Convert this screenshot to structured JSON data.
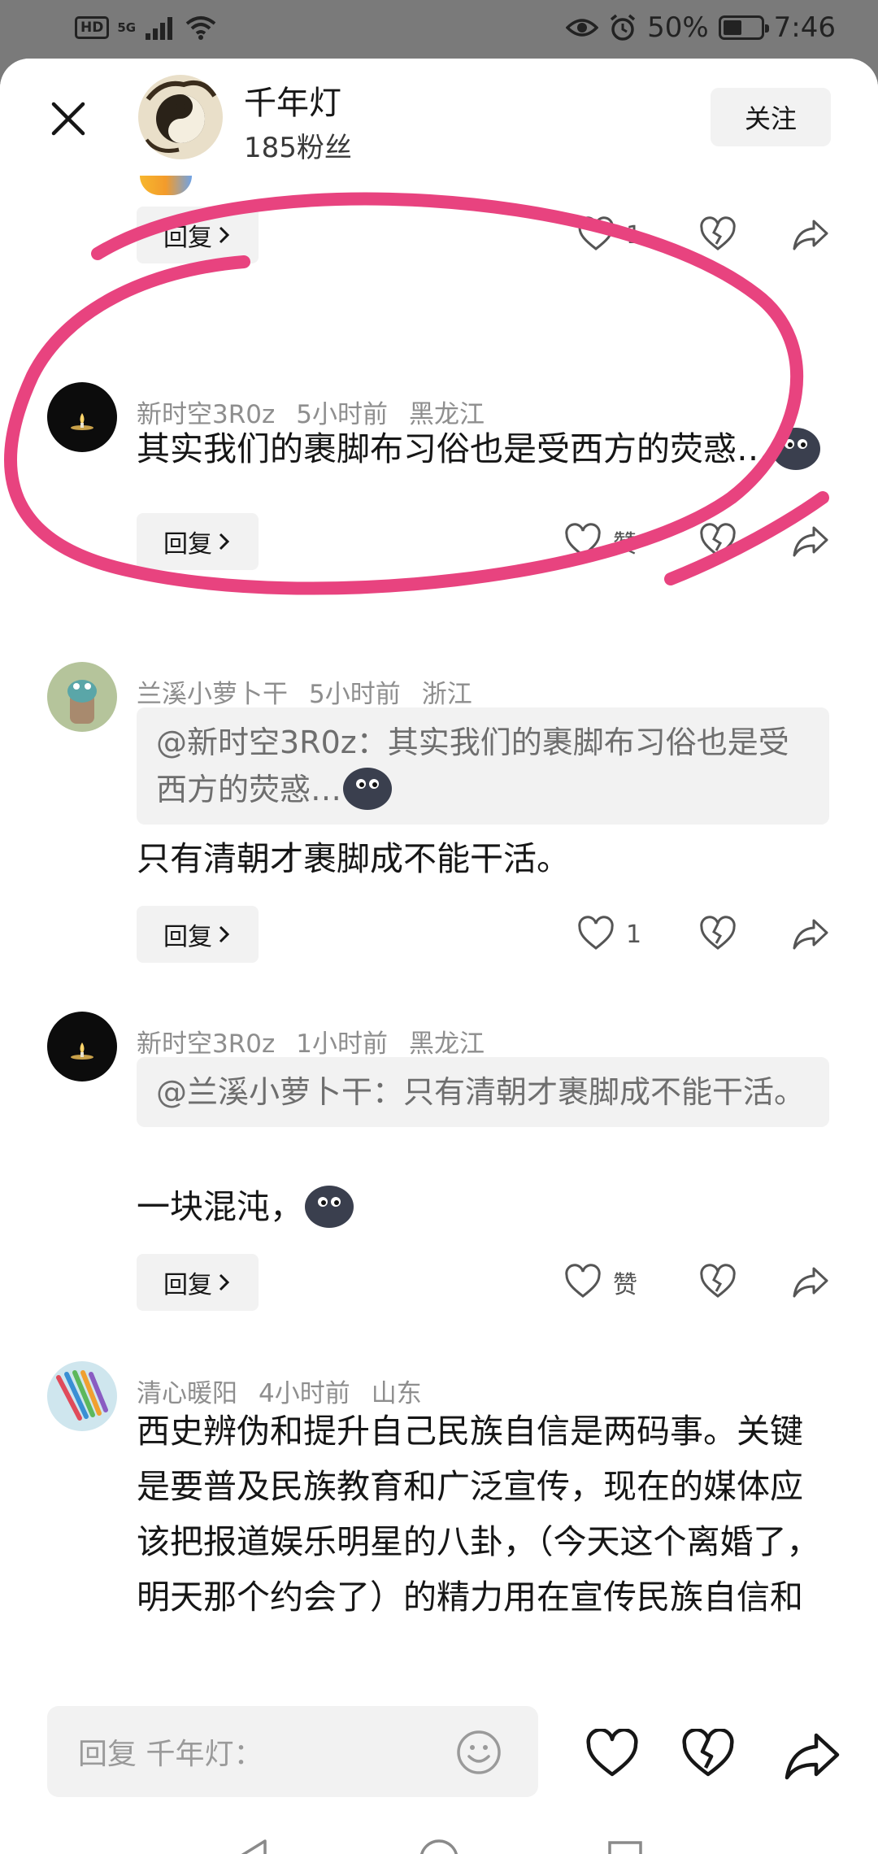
{
  "status_bar": {
    "hd_label": "HD",
    "network_label": "5G",
    "battery_text": "50%",
    "battery_level": 0.5,
    "time": "7:46"
  },
  "header": {
    "author_name": "千年灯",
    "author_fans": "185粉丝",
    "follow_label": "关注"
  },
  "top_partial": {
    "reply_label": "回复",
    "like_count": "1"
  },
  "comments": [
    {
      "username": "新时空3R0z",
      "time": "5小时前",
      "location": "黑龙江",
      "quote": "",
      "text": "其实我们的裹脚布习俗也是受西方的荧惑…",
      "reply_label": "回复",
      "like_label": "赞"
    },
    {
      "username": "兰溪小萝卜干",
      "time": "5小时前",
      "location": "浙江",
      "quote": "@新时空3R0z：其实我们的裹脚布习俗也是受西方的荧惑…",
      "text": "只有清朝才裹脚成不能干活。",
      "reply_label": "回复",
      "like_label": "1"
    },
    {
      "username": "新时空3R0z",
      "time": "1小时前",
      "location": "黑龙江",
      "quote": "@兰溪小萝卜干：只有清朝才裹脚成不能干活。",
      "text": "一块混沌，",
      "reply_label": "回复",
      "like_label": "赞"
    },
    {
      "username": "清心暖阳",
      "time": "4小时前",
      "location": "山东",
      "quote": "",
      "text": "西史辨伪和提升自己民族自信是两码事。关键是要普及民族教育和广泛宣传，现在的媒体应该把报道娱乐明星的八卦，（今天这个离婚了，明天那个约会了）的精力用在宣传民族自信和民族"
    }
  ],
  "bottom": {
    "reply_placeholder": "回复 千年灯："
  },
  "colors": {
    "annotation_pink": "#e8437f",
    "status_bar_bg": "#7a7a7a",
    "muted_text": "#8e8e8e",
    "quote_bg": "#f2f2f2"
  },
  "icons": [
    "close-icon",
    "heart-icon",
    "broken-heart-icon",
    "share-icon",
    "emoji-icon",
    "chevron-right-icon",
    "back-triangle-icon",
    "home-circle-icon",
    "recents-square-icon",
    "eye-icon",
    "alarm-icon",
    "wifi-icon",
    "signal-icon"
  ]
}
